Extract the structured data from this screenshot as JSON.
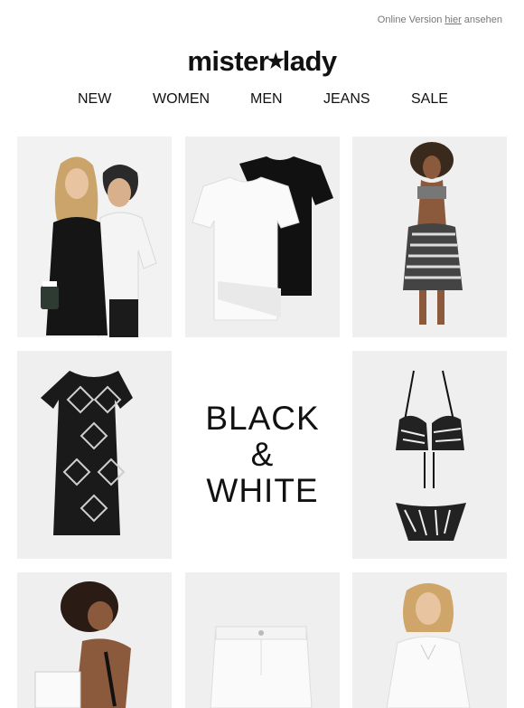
{
  "topbar": {
    "prefix": "Online Version ",
    "link": "hier",
    "suffix": " ansehen"
  },
  "brand": {
    "left": "mister",
    "star": "★",
    "right": "lady"
  },
  "nav": [
    "NEW",
    "WOMEN",
    "MEN",
    "JEANS",
    "SALE"
  ],
  "promo": {
    "line1": "BLACK",
    "line2": "&",
    "line3": "WHITE"
  },
  "products": [
    {
      "id": "couple-outfit"
    },
    {
      "id": "tshirts-black-white"
    },
    {
      "id": "bikini-pareo"
    },
    {
      "id": "pattern-dress"
    },
    {
      "id": "zebra-bikini"
    },
    {
      "id": "model-side-bag"
    },
    {
      "id": "white-shorts"
    },
    {
      "id": "white-blouse-dress"
    }
  ]
}
